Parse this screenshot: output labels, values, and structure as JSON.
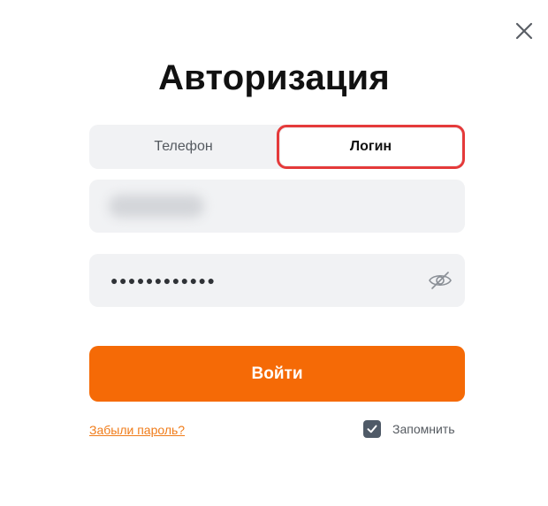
{
  "close": {
    "icon": "close-icon"
  },
  "title": "Авторизация",
  "tabs": [
    {
      "label": "Телефон",
      "active": false
    },
    {
      "label": "Логин",
      "active": true
    }
  ],
  "login_field": {
    "value": ""
  },
  "password_field": {
    "masked_value": "●●●●●●●●●●●●",
    "toggle_icon": "eye-off-icon"
  },
  "submit": {
    "label": "Войти"
  },
  "forgot": {
    "label": "Забыли пароль?"
  },
  "remember": {
    "label": "Запомнить",
    "checked": true
  },
  "colors": {
    "accent": "#f56a06",
    "link": "#f07c1a",
    "field_bg": "#f1f2f4",
    "highlight": "#e53a3a"
  }
}
